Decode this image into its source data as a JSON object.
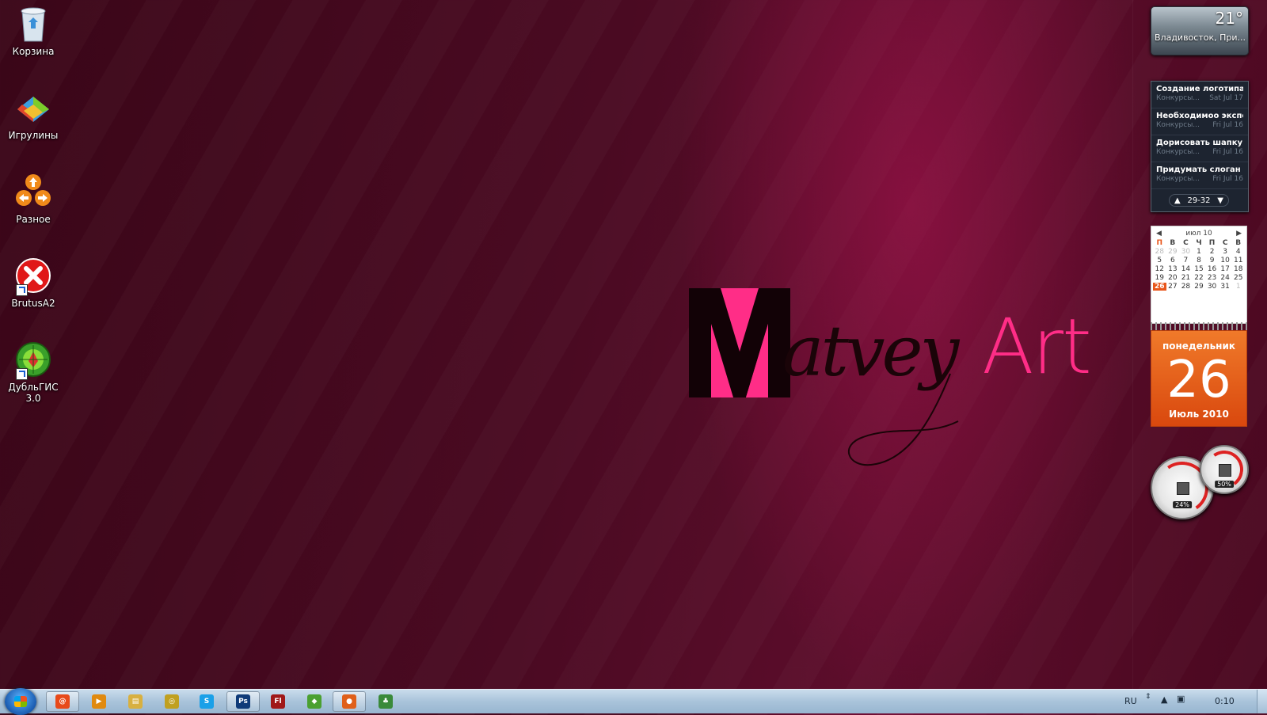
{
  "desktop": {
    "icons": [
      {
        "label": "Корзина"
      },
      {
        "label": "Игрулины"
      },
      {
        "label": "Разное"
      },
      {
        "label": "BrutusA2"
      },
      {
        "label": "ДубльГИС 3.0"
      }
    ]
  },
  "wallpaper": {
    "logo_m": "M",
    "logo_script": "atvey",
    "logo_art": "Art"
  },
  "weather": {
    "temp": "21°",
    "city": "Владивосток, При..."
  },
  "feed": {
    "items": [
      {
        "title": "Создание логотипа ...",
        "source": "Конкурсы...",
        "date": "Sat Jul 17"
      },
      {
        "title": "Необходимоо экспе...",
        "source": "Конкурсы...",
        "date": "Fri Jul 16"
      },
      {
        "title": "Дорисовать шапку ...",
        "source": "Конкурсы...",
        "date": "Fri Jul 16"
      },
      {
        "title": "Придумать слоган",
        "source": "Конкурсы...",
        "date": "Fri Jul 16"
      }
    ],
    "range": "29-32"
  },
  "calendar": {
    "month_label": "июл 10",
    "day_names": [
      "П",
      "В",
      "С",
      "Ч",
      "П",
      "С",
      "В"
    ],
    "weeks": [
      [
        "28",
        "29",
        "30",
        "1",
        "2",
        "3",
        "4"
      ],
      [
        "5",
        "6",
        "7",
        "8",
        "9",
        "10",
        "11"
      ],
      [
        "12",
        "13",
        "14",
        "15",
        "16",
        "17",
        "18"
      ],
      [
        "19",
        "20",
        "21",
        "22",
        "23",
        "24",
        "25"
      ],
      [
        "26",
        "27",
        "28",
        "29",
        "30",
        "31",
        "1"
      ]
    ],
    "weekday": "понедельник",
    "day": "26",
    "month_year": "Июль 2010"
  },
  "meter": {
    "cpu": "24%",
    "ram": "50%"
  },
  "taskbar": {
    "apps": [
      {
        "name": "mail-agent-icon",
        "glyph": "@",
        "color": "#e84a1a"
      },
      {
        "name": "media-player-icon",
        "glyph": "▶",
        "color": "#e08a10"
      },
      {
        "name": "explorer-icon",
        "glyph": "▤",
        "color": "#d8b040"
      },
      {
        "name": "network-icon",
        "glyph": "◎",
        "color": "#c0a020"
      },
      {
        "name": "skype-icon",
        "glyph": "S",
        "color": "#1aa0e8"
      },
      {
        "name": "photoshop-icon",
        "glyph": "Ps",
        "color": "#0f3a78"
      },
      {
        "name": "flash-icon",
        "glyph": "Fl",
        "color": "#a01818"
      },
      {
        "name": "map-icon",
        "glyph": "◆",
        "color": "#4aa030"
      },
      {
        "name": "firefox-icon",
        "glyph": "●",
        "color": "#e0601a"
      },
      {
        "name": "utility-icon",
        "glyph": "♣",
        "color": "#3a8a3a"
      }
    ],
    "lang": "RU",
    "time": "0:10"
  }
}
